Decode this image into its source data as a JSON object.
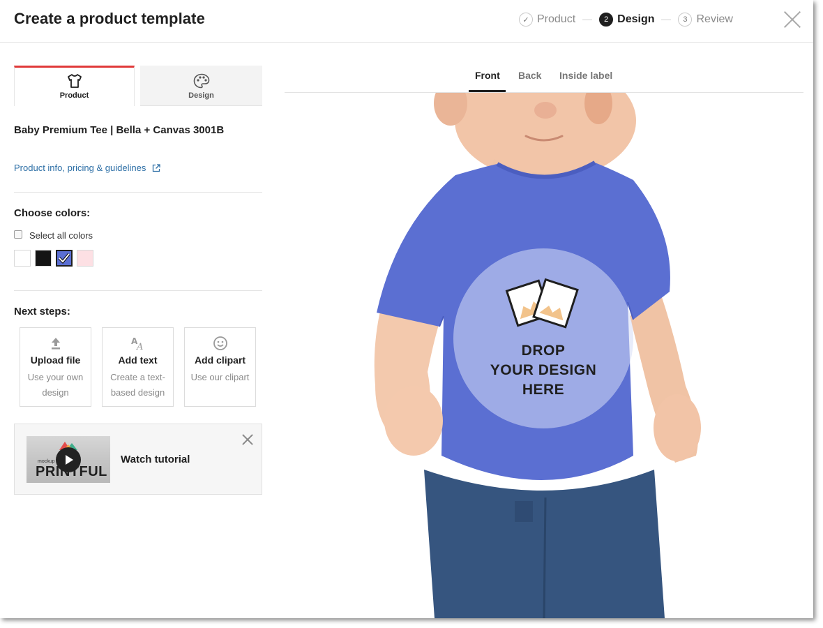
{
  "header": {
    "title": "Create a product template",
    "steps": [
      {
        "num": "✓",
        "label": "Product",
        "state": "done"
      },
      {
        "num": "2",
        "label": "Design",
        "state": "active"
      },
      {
        "num": "3",
        "label": "Review",
        "state": "pending"
      }
    ]
  },
  "sidebar": {
    "tabs": [
      {
        "label": "Product",
        "icon": "tshirt-icon",
        "active": true
      },
      {
        "label": "Design",
        "icon": "palette-icon",
        "active": false
      }
    ],
    "product_name": "Baby Premium Tee | Bella + Canvas 3001B",
    "info_link": "Product info, pricing & guidelines",
    "colors": {
      "heading": "Choose colors:",
      "select_all": "Select all colors",
      "swatches": [
        "#ffffff",
        "#141414",
        "#5b6fd2",
        "#fde0e4"
      ],
      "selected_index": 2
    },
    "next_steps": {
      "heading": "Next steps:",
      "cards": [
        {
          "title": "Upload file",
          "subtitle": "Use your own design",
          "icon": "upload-icon"
        },
        {
          "title": "Add text",
          "subtitle": "Create a text-based design",
          "icon": "text-icon"
        },
        {
          "title": "Add clipart",
          "subtitle": "Use our clipart",
          "icon": "smiley-icon"
        }
      ]
    },
    "tutorial": {
      "label": "Watch tutorial",
      "thumb_brand": "PRINTFUL",
      "thumb_caption": "mockup generator:"
    }
  },
  "main": {
    "view_tabs": [
      {
        "label": "Front",
        "active": true
      },
      {
        "label": "Back",
        "active": false
      },
      {
        "label": "Inside label",
        "active": false
      }
    ],
    "drop_zone": "DROP\nYOUR DESIGN\nHERE",
    "shirt_color": "#5b6fd2"
  }
}
